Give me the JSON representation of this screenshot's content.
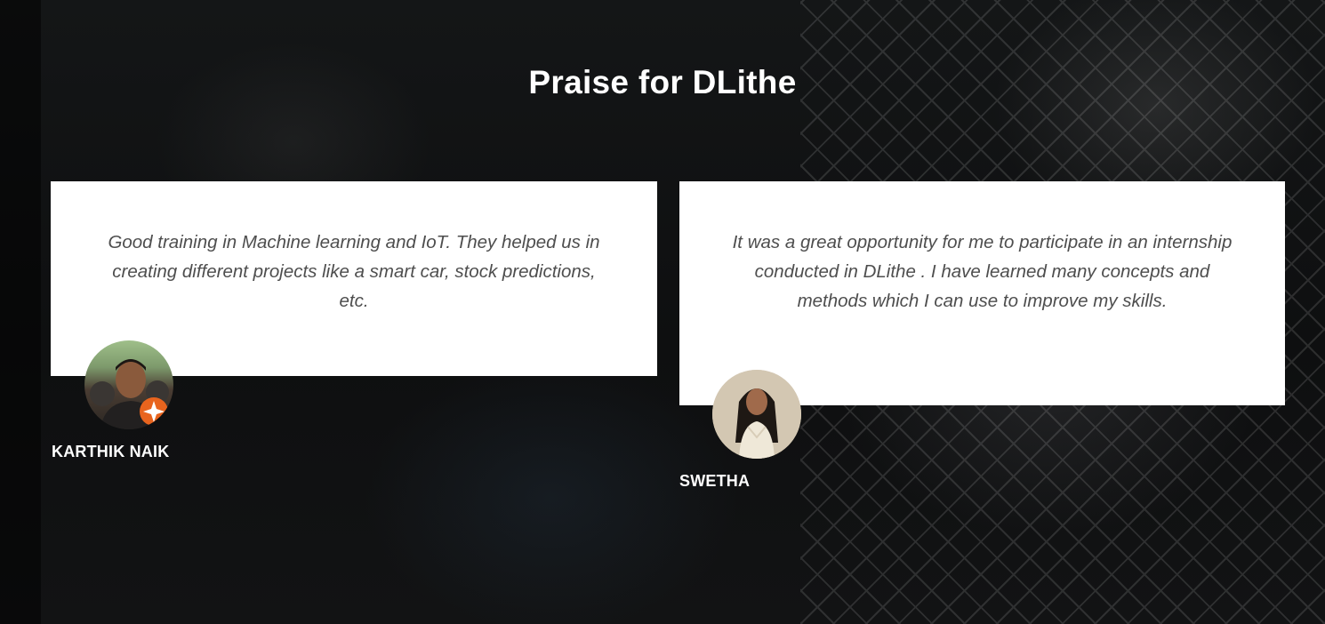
{
  "section": {
    "title": "Praise for DLithe"
  },
  "testimonials": [
    {
      "quote": "Good training in Machine learning and IoT. They helped us in creating different projects like a smart car, stock predictions, etc.",
      "name": "KARTHIK NAIK"
    },
    {
      "quote": "It was a great opportunity for me to participate in an internship conducted in DLithe . I have learned many concepts and methods which I can use to improve my skills.",
      "name": "SWETHA"
    }
  ],
  "colors": {
    "card_background": "#ffffff",
    "quote_text": "#4e4e4e",
    "heading_text": "#ffffff",
    "badge_accent": "#e8641e"
  }
}
